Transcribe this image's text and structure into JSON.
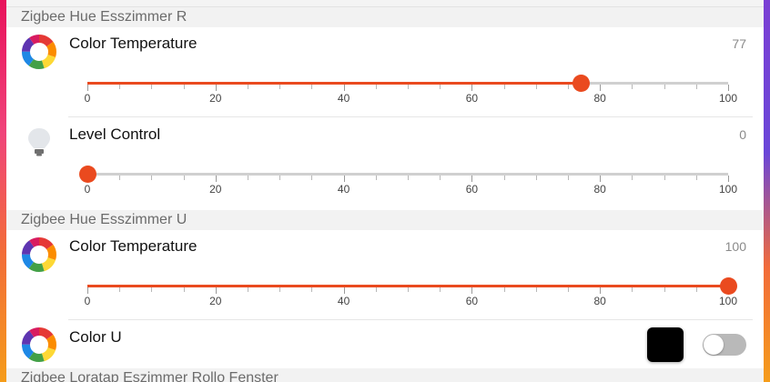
{
  "colors": {
    "accent": "#ea4a1f",
    "track": "#d0d0d0",
    "header_bg": "#f2f2f2"
  },
  "groups": [
    {
      "header": "Zigbee Hue Esszimmer R",
      "items": [
        {
          "icon": "color-wheel-icon",
          "title": "Color Temperature",
          "value": "77",
          "slider_value": 77,
          "tick_labels": [
            "0",
            "20",
            "40",
            "60",
            "80",
            "100"
          ]
        },
        {
          "icon": "light-bulb-icon",
          "title": "Level Control",
          "value": "0",
          "slider_value": 0,
          "tick_labels": [
            "0",
            "20",
            "40",
            "60",
            "80",
            "100"
          ]
        }
      ]
    },
    {
      "header": "Zigbee Hue Esszimmer U",
      "items": [
        {
          "icon": "color-wheel-icon",
          "title": "Color Temperature",
          "value": "100",
          "slider_value": 100,
          "tick_labels": [
            "0",
            "20",
            "40",
            "60",
            "80",
            "100"
          ]
        },
        {
          "icon": "color-wheel-icon",
          "title": "Color U",
          "swatch_color": "#000000",
          "toggle_on": false
        }
      ]
    },
    {
      "header": "Zigbee Loratap Eszimmer Rollo Fenster"
    }
  ]
}
